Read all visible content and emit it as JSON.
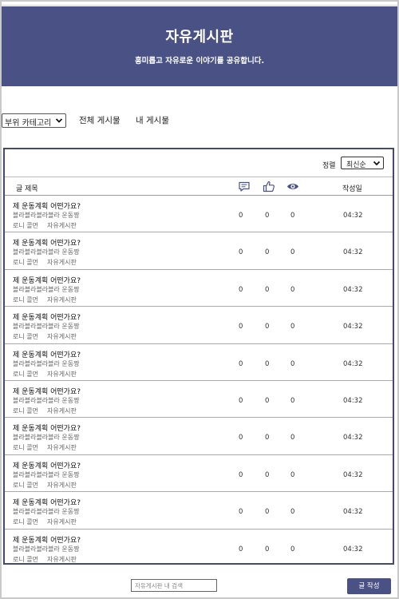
{
  "header": {
    "title": "자유게시판",
    "subtitle": "흥미롭고 자유로운 이야기를 공유합니다."
  },
  "nav": {
    "category_select": "부위 카테고리",
    "all_posts": "전체 게시물",
    "my_posts": "내 게시물"
  },
  "board": {
    "sort_label": "정렬",
    "sort_value": "최신순",
    "columns": {
      "title": "글 제목",
      "comments_icon": "comment-icon",
      "likes_icon": "thumbs-up-icon",
      "views_icon": "eye-icon",
      "date": "작성일"
    },
    "posts": [
      {
        "title": "제 운동계획 어떤가요?",
        "preview": "블라블라블라블라 운동짱",
        "author": "로니 콜먼",
        "board": "자유게시판",
        "comments": "0",
        "likes": "0",
        "views": "0",
        "time": "04:32"
      },
      {
        "title": "제 운동계획 어떤가요?",
        "preview": "블라블라블라블라 운동짱",
        "author": "로니 콜먼",
        "board": "자유게시판",
        "comments": "0",
        "likes": "0",
        "views": "0",
        "time": "04:32"
      },
      {
        "title": "제 운동계획 어떤가요?",
        "preview": "블라블라블라블라 운동짱",
        "author": "로니 콜먼",
        "board": "자유게시판",
        "comments": "0",
        "likes": "0",
        "views": "0",
        "time": "04:32"
      },
      {
        "title": "제 운동계획 어떤가요?",
        "preview": "블라블라블라블라 운동짱",
        "author": "로니 콜먼",
        "board": "자유게시판",
        "comments": "0",
        "likes": "0",
        "views": "0",
        "time": "04:32"
      },
      {
        "title": "제 운동계획 어떤가요?",
        "preview": "블라블라블라블라 운동짱",
        "author": "로니 콜먼",
        "board": "자유게시판",
        "comments": "0",
        "likes": "0",
        "views": "0",
        "time": "04:32"
      },
      {
        "title": "제 운동계획 어떤가요?",
        "preview": "블라블라블라블라 운동짱",
        "author": "로니 콜먼",
        "board": "자유게시판",
        "comments": "0",
        "likes": "0",
        "views": "0",
        "time": "04:32"
      },
      {
        "title": "제 운동계획 어떤가요?",
        "preview": "블라블라블라블라 운동짱",
        "author": "로니 콜먼",
        "board": "자유게시판",
        "comments": "0",
        "likes": "0",
        "views": "0",
        "time": "04:32"
      },
      {
        "title": "제 운동계획 어떤가요?",
        "preview": "블라블라블라블라 운동짱",
        "author": "로니 콜먼",
        "board": "자유게시판",
        "comments": "0",
        "likes": "0",
        "views": "0",
        "time": "04:32"
      },
      {
        "title": "제 운동계획 어떤가요?",
        "preview": "블라블라블라블라 운동짱",
        "author": "로니 콜먼",
        "board": "자유게시판",
        "comments": "0",
        "likes": "0",
        "views": "0",
        "time": "04:32"
      },
      {
        "title": "제 운동계획 어떤가요?",
        "preview": "블라블라블라블라 운동짱",
        "author": "로니 콜먼",
        "board": "자유게시판",
        "comments": "0",
        "likes": "0",
        "views": "0",
        "time": "04:32"
      }
    ]
  },
  "footer": {
    "search_placeholder": "자유게시판 내 검색",
    "write_button": "글 작성"
  },
  "colors": {
    "accent": "#4a5285",
    "board_border": "#444a6b"
  }
}
